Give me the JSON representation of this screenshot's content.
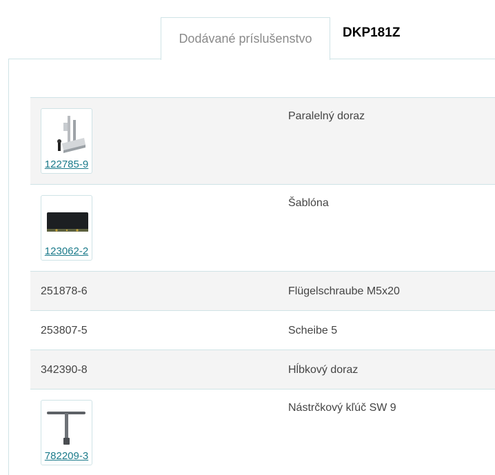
{
  "tabs": {
    "active_label": "Dodávané príslušenstvo"
  },
  "product_code": "DKP181Z",
  "accessories": [
    {
      "code": "122785-9",
      "name": "Paralelný doraz",
      "has_image": true,
      "icon": "parallel-guide-image"
    },
    {
      "code": "123062-2",
      "name": "Šablóna",
      "has_image": true,
      "icon": "template-image"
    },
    {
      "code": "251878-6",
      "name": "Flügelschraube M5x20",
      "has_image": false
    },
    {
      "code": "253807-5",
      "name": "Scheibe 5",
      "has_image": false
    },
    {
      "code": "342390-8",
      "name": "Hĺbkový doraz",
      "has_image": false
    },
    {
      "code": "782209-3",
      "name": "Nástrčkový kľúč SW 9",
      "has_image": true,
      "icon": "socket-wrench-image"
    }
  ],
  "colors": {
    "border": "#cfe3e6",
    "link": "#1a7a8a",
    "row_shade": "#f4f4f4"
  }
}
